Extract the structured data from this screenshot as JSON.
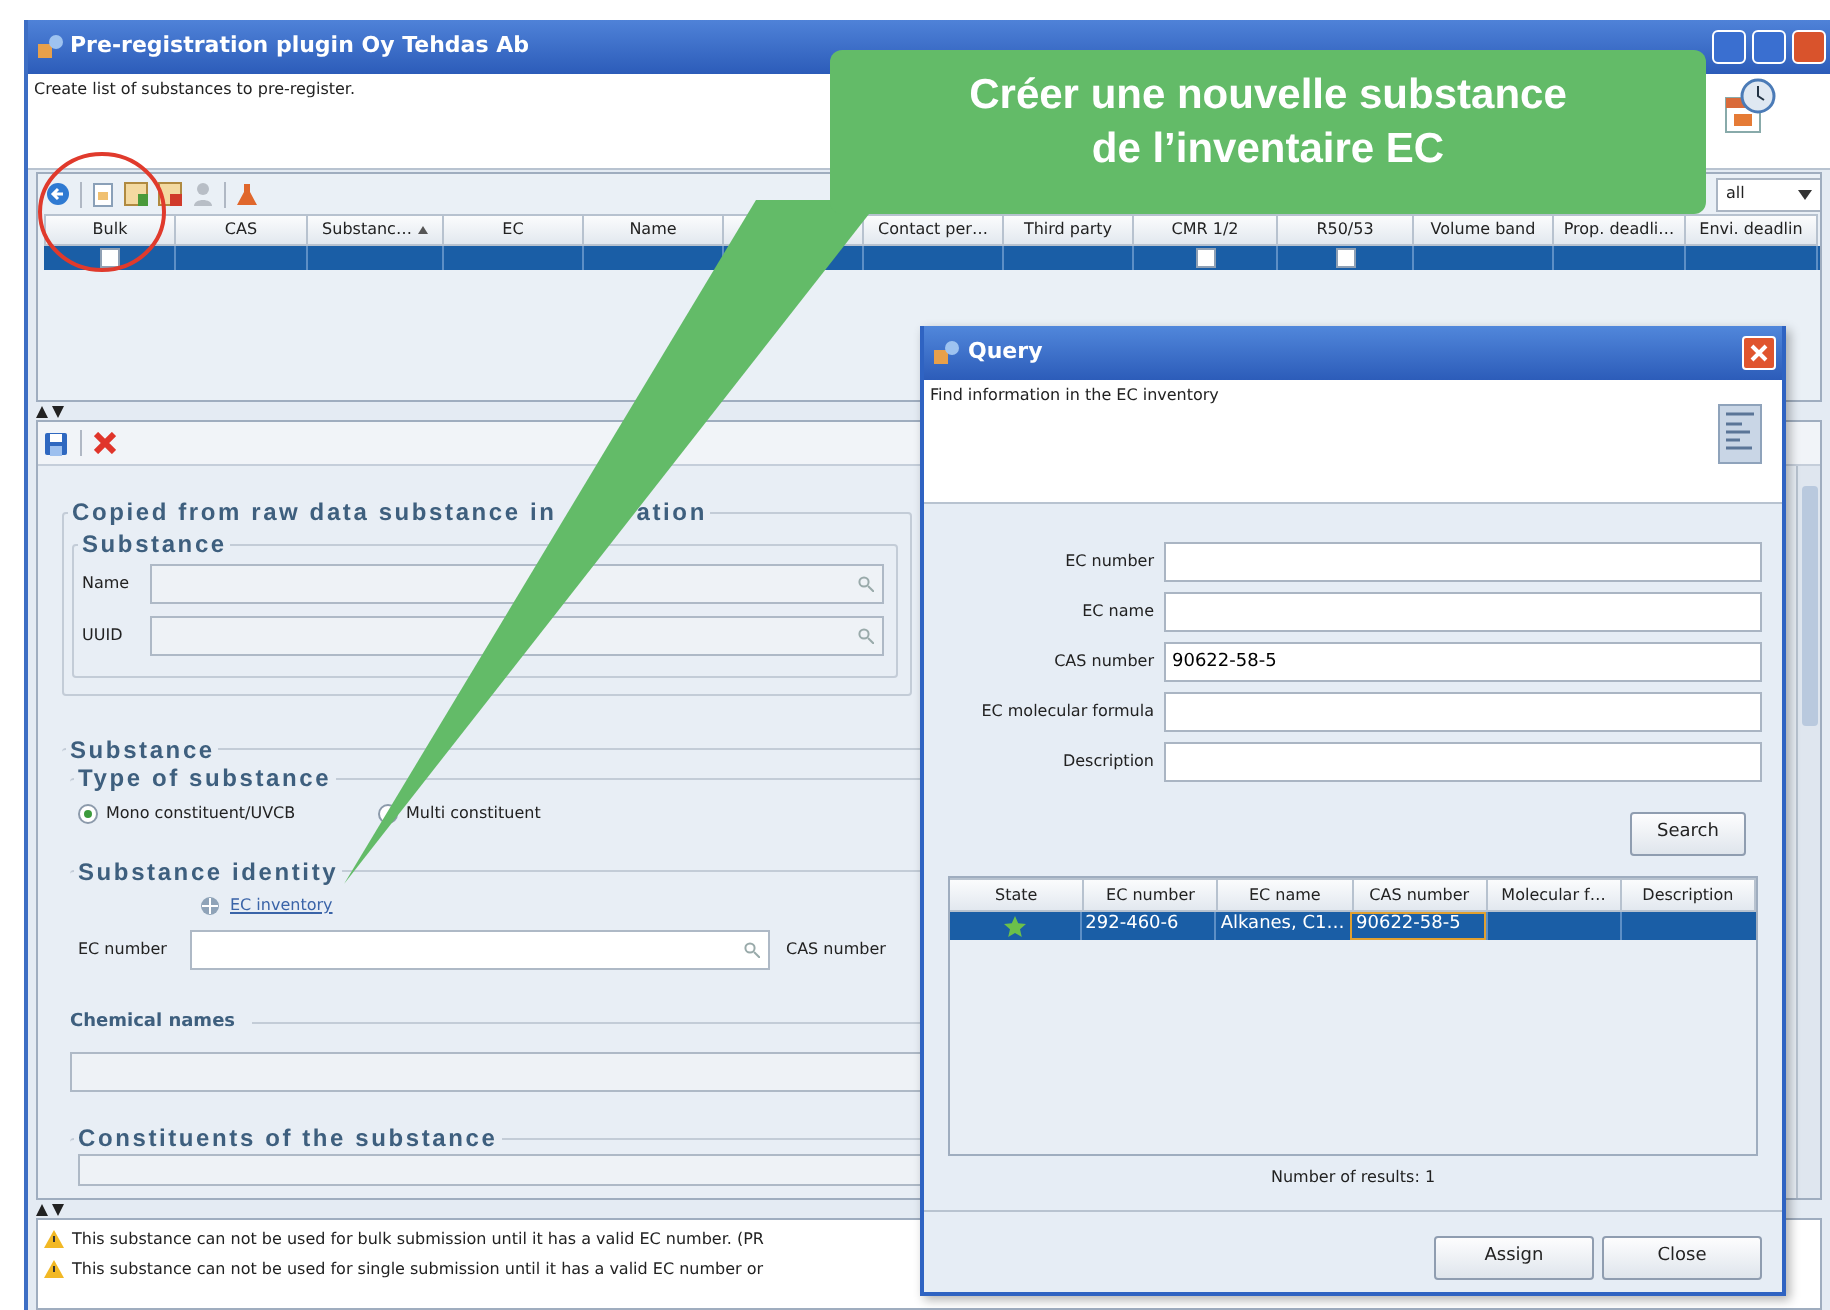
{
  "window": {
    "title": "Pre-registration plugin Oy Tehdas Ab",
    "description": "Create list of substances to pre-register."
  },
  "substance_table": {
    "filter": "all",
    "columns": [
      {
        "label": "Bulk",
        "kind": "check",
        "sorted": false
      },
      {
        "label": "CAS",
        "kind": "text",
        "sorted": false
      },
      {
        "label": "Substanc…",
        "kind": "text",
        "sorted": true
      },
      {
        "label": "EC",
        "kind": "text",
        "sorted": false
      },
      {
        "label": "Name",
        "kind": "text",
        "sorted": false
      },
      {
        "kind": "text",
        "sorted": false
      },
      {
        "label": "Contact per…",
        "kind": "text",
        "sorted": false
      },
      {
        "label": "Third party",
        "kind": "text",
        "sorted": false
      },
      {
        "label": "CMR 1/2",
        "kind": "check",
        "sorted": false
      },
      {
        "label": "R50/53",
        "kind": "check",
        "sorted": false
      },
      {
        "label": "Volume band",
        "kind": "text",
        "sorted": false
      },
      {
        "label": "Prop. deadli…",
        "kind": "text",
        "sorted": false
      },
      {
        "label": "Envi. deadlin",
        "kind": "text",
        "sorted": false
      }
    ],
    "rows": [
      {
        "selected": true,
        "checkboxes": [
          {
            "checked": false
          },
          {
            "checked": false
          },
          {
            "checked": false
          }
        ]
      }
    ]
  },
  "detail": {
    "raw_group": {
      "title_parts": [
        "Copied from raw data substance in",
        "ation"
      ],
      "subgroup_title": "Substance",
      "fields": [
        {
          "label": "Name"
        },
        {
          "label": "UUID"
        }
      ]
    },
    "substance_group": {
      "title": "Substance",
      "type_group": {
        "title": "Type of substance",
        "options": [
          {
            "label": "Mono constituent/UVCB",
            "selected": true
          },
          {
            "label": "Multi constituent",
            "selected": false
          }
        ]
      },
      "identity_group": {
        "title": "Substance identity",
        "link": "EC inventory",
        "ec_label": "EC number",
        "cas_label": "CAS number"
      },
      "chemical_names_title": "Chemical names",
      "constituents_title": "Constituents of the substance"
    }
  },
  "messages": [
    {
      "text": "This substance can not be used for bulk submission until it has a valid EC number. (PR"
    },
    {
      "text": "This substance can not be used for single submission until it has a valid EC number or"
    }
  ],
  "query": {
    "title": "Query",
    "description": "Find information in the EC inventory",
    "fields": [
      {
        "label": "EC number"
      },
      {
        "label": "EC name"
      },
      {
        "label": "CAS number",
        "value": "90622-58-5"
      },
      {
        "label": "EC molecular formula"
      },
      {
        "label": "Description"
      }
    ],
    "search_button": "Search",
    "results": {
      "columns": [
        "State",
        "EC number",
        "EC name",
        "CAS number",
        "Molecular f…",
        "Description"
      ],
      "rows": [
        {
          "selected": true,
          "starred": true,
          "cells": [
            "",
            "292-460-6",
            "Alkanes, C1…",
            "90622-58-5"
          ]
        }
      ]
    },
    "count": "Number of results: 1",
    "buttons": [
      "Assign",
      "Close"
    ]
  },
  "callout": {
    "lines": [
      "Créer une nouvelle substance",
      "de l’inventaire EC"
    ]
  },
  "annotation": {
    "circle_around_toolbar": true
  }
}
